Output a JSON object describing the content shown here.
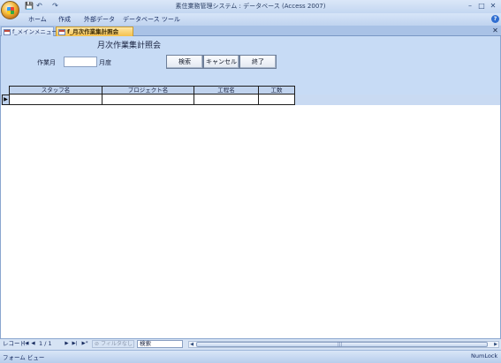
{
  "window": {
    "title": "素住業務管理システム : データベース (Access 2007)",
    "controls": {
      "minimize": "–",
      "maximize": "□",
      "close": "✕"
    }
  },
  "quick_access": {
    "save": "💾",
    "undo": "↶",
    "redo": "↷"
  },
  "ribbon_tabs": [
    "ホーム",
    "作成",
    "外部データ",
    "データベース ツール"
  ],
  "document_tabs": [
    {
      "label": "f_メインメニュー",
      "active": false
    },
    {
      "label": "f_月次作業集計照会",
      "active": true
    }
  ],
  "tab_close": "✕",
  "form": {
    "title": "月次作業集計照会",
    "month_label": "作業月",
    "month_value": "",
    "month_suffix": "月度",
    "buttons": {
      "search": "検索",
      "cancel": "キャンセル",
      "exit": "終了"
    }
  },
  "grid": {
    "columns": [
      "スタッフ名",
      "プロジェクト名",
      "工程名",
      "工数"
    ],
    "row_selector": "▶"
  },
  "navigation": {
    "record_label": "レコード:",
    "first": "|◀",
    "prev": "◀",
    "position": "1 / 1",
    "next": "▶",
    "last": "▶|",
    "new": "▶*",
    "filter": "フィルタなし",
    "search_text": "検索",
    "scroll_left": "◀",
    "scroll_right": "▶",
    "thumb_grip": "|||"
  },
  "status": {
    "view": "フォーム ビュー",
    "numlock": "NumLock"
  },
  "colors": {
    "accent_tab": "#f5c04c",
    "header_bg": "#c7dbf5"
  }
}
